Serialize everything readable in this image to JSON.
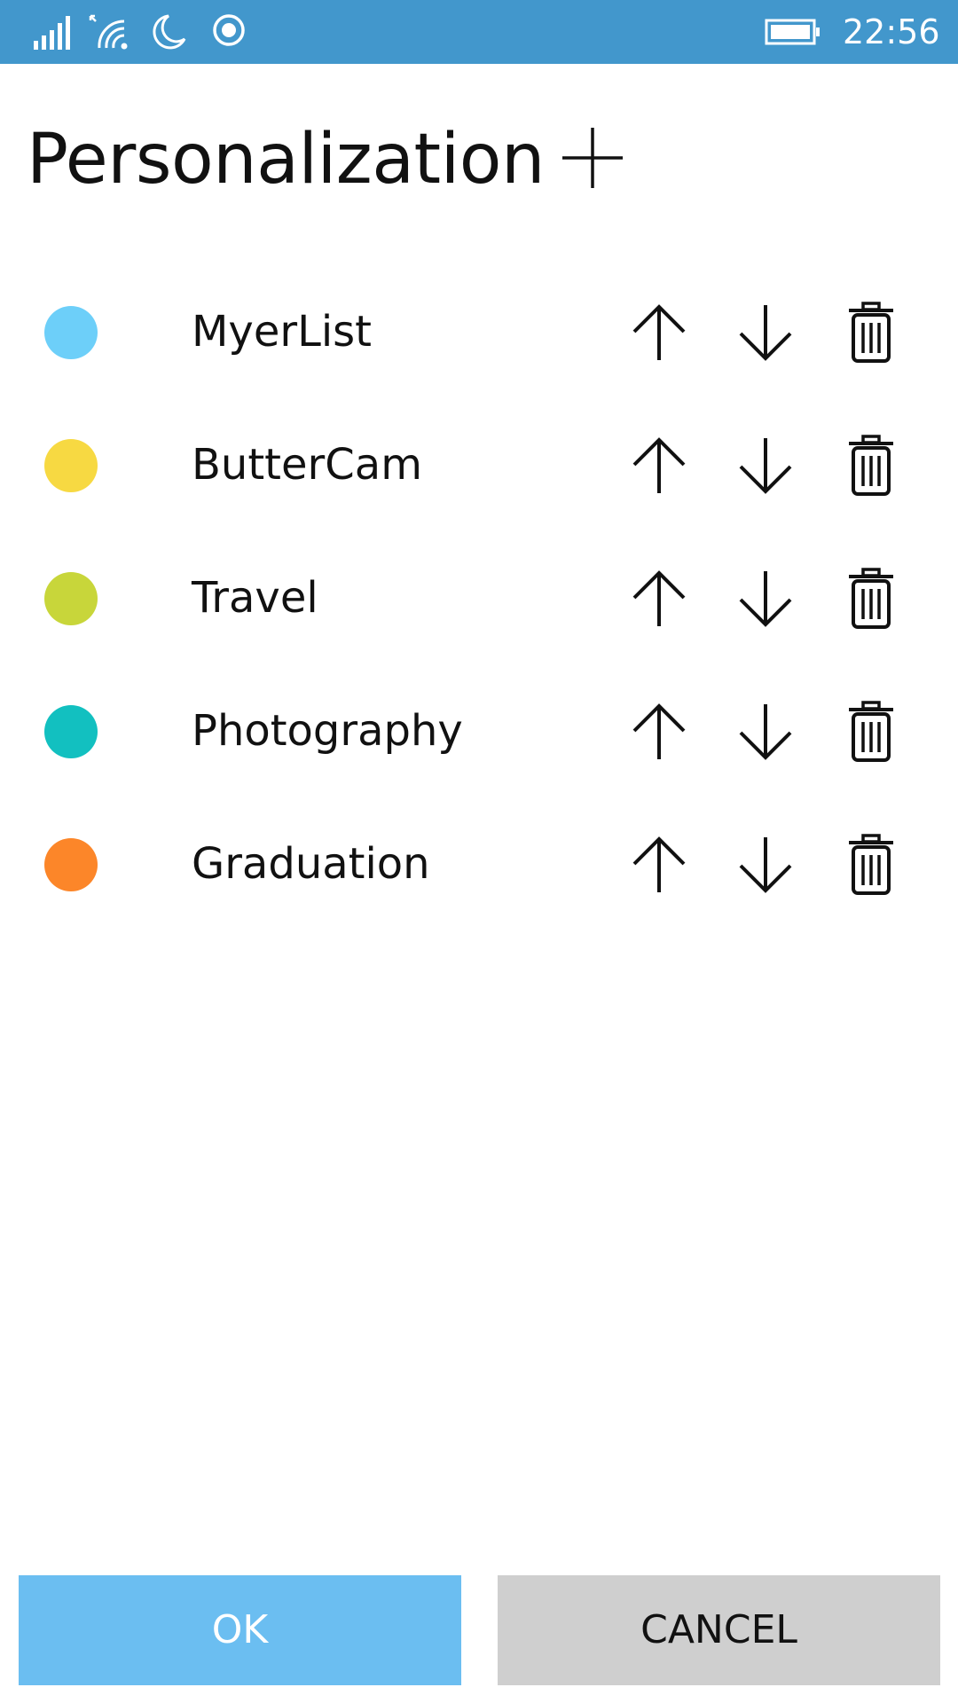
{
  "status_bar": {
    "time": "22:56",
    "icons": [
      "signal-icon",
      "wifi-icon",
      "moon-icon",
      "record-icon",
      "battery-icon"
    ],
    "background": "#4297cc"
  },
  "header": {
    "title": "Personalization",
    "add_icon": "plus-icon"
  },
  "categories": [
    {
      "name": "MyerList",
      "color": "#6dcff9"
    },
    {
      "name": "ButterCam",
      "color": "#f7d942"
    },
    {
      "name": "Travel",
      "color": "#c8d63a"
    },
    {
      "name": "Photography",
      "color": "#12c0c0"
    },
    {
      "name": "Graduation",
      "color": "#fc8629"
    }
  ],
  "row_actions": {
    "up_icon": "arrow-up-icon",
    "down_icon": "arrow-down-icon",
    "delete_icon": "trash-icon"
  },
  "footer": {
    "ok_label": "OK",
    "cancel_label": "CANCEL",
    "ok_color": "#6bbef1",
    "cancel_color": "#cfcfcf"
  }
}
